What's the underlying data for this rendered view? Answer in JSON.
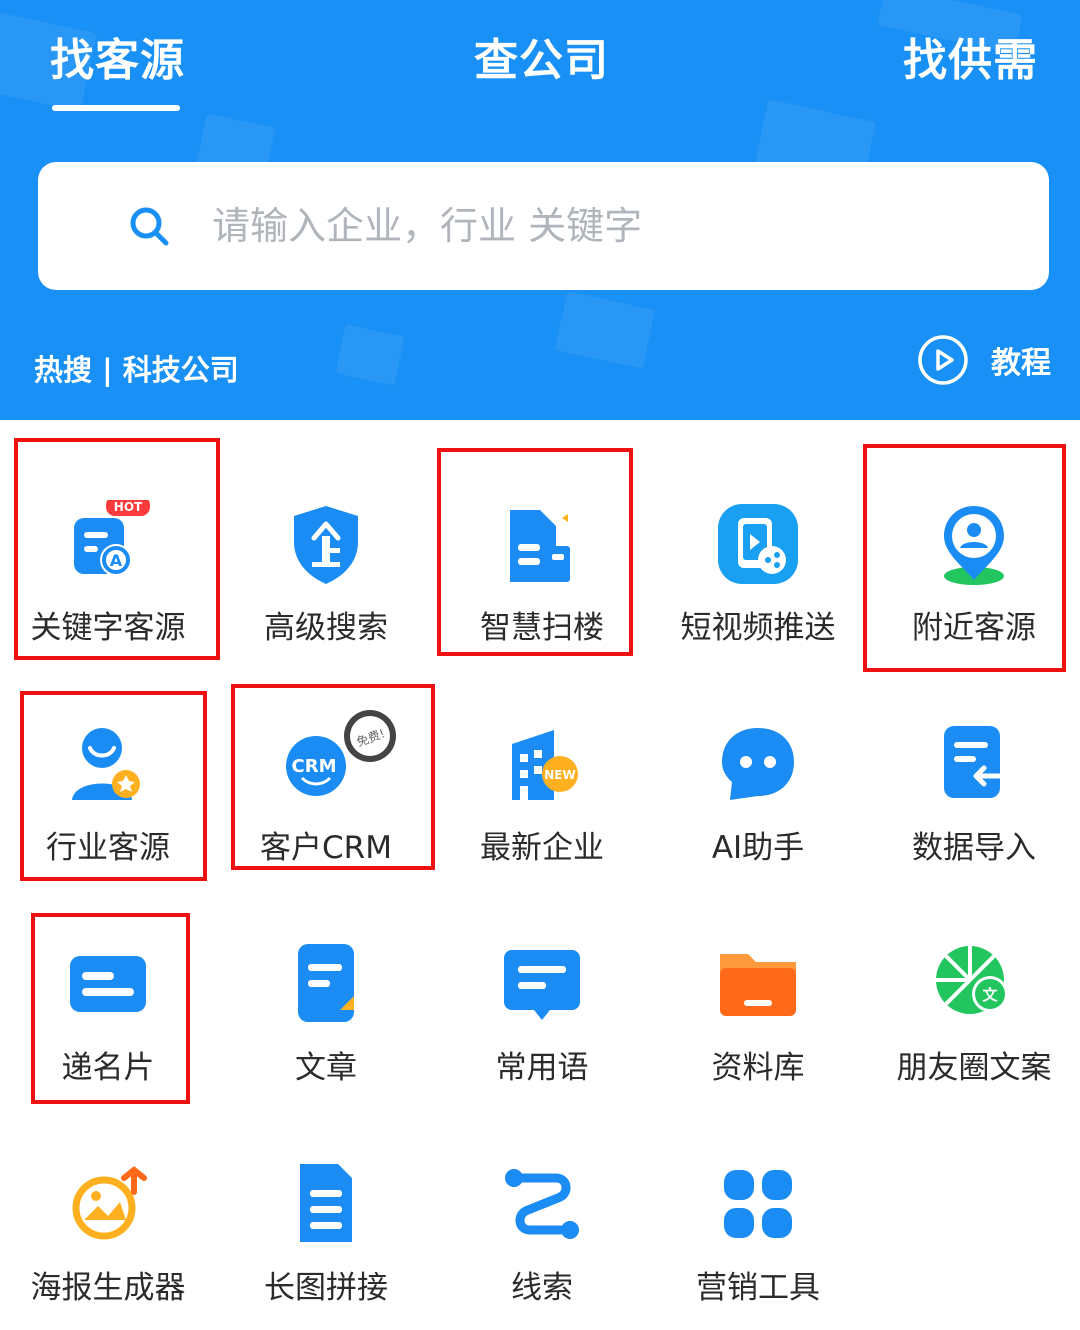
{
  "colors": {
    "primary": "#1890f5",
    "highlight": "#ee1111",
    "icon_blue": "#1a8cf3",
    "icon_orange": "#ff7a1a",
    "icon_green": "#22c55e"
  },
  "tabs": [
    {
      "label": "找客源",
      "active": true
    },
    {
      "label": "查公司",
      "active": false
    },
    {
      "label": "找供需",
      "active": false
    }
  ],
  "search": {
    "placeholder": "请输入企业，行业 关键字",
    "value": "",
    "icon": "search-icon"
  },
  "hot_search": "热搜 | 科技公司",
  "tutorial": {
    "label": "教程",
    "icon": "play-circle-icon"
  },
  "grid": [
    {
      "label": "关键字客源",
      "icon": "keyword-search-icon",
      "badge": "HOT"
    },
    {
      "label": "高级搜索",
      "icon": "shield-enterprise-icon"
    },
    {
      "label": "智慧扫楼",
      "icon": "building-scan-icon"
    },
    {
      "label": "短视频推送",
      "icon": "video-share-icon"
    },
    {
      "label": "附近客源",
      "icon": "nearby-location-icon"
    },
    {
      "label": "行业客源",
      "icon": "industry-user-icon"
    },
    {
      "label": "客户CRM",
      "icon": "crm-icon",
      "badge": "免费!"
    },
    {
      "label": "最新企业",
      "icon": "new-company-icon",
      "badge": "NEW"
    },
    {
      "label": "AI助手",
      "icon": "ai-chat-icon"
    },
    {
      "label": "数据导入",
      "icon": "data-import-icon"
    },
    {
      "label": "递名片",
      "icon": "business-card-icon"
    },
    {
      "label": "文章",
      "icon": "article-icon"
    },
    {
      "label": "常用语",
      "icon": "common-phrases-icon"
    },
    {
      "label": "资料库",
      "icon": "folder-icon"
    },
    {
      "label": "朋友圈文案",
      "icon": "moments-copy-icon"
    },
    {
      "label": "海报生成器",
      "icon": "poster-generator-icon"
    },
    {
      "label": "长图拼接",
      "icon": "long-image-icon"
    },
    {
      "label": "线索",
      "icon": "clue-icon"
    },
    {
      "label": "营销工具",
      "icon": "marketing-tools-icon"
    }
  ]
}
